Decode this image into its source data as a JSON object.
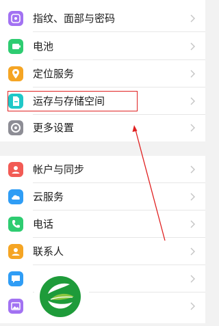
{
  "settings": {
    "items": [
      {
        "label": "指纹、面部与密码",
        "icon": "fingerprint-face-icon",
        "color": "#a272f2"
      },
      {
        "label": "电池",
        "icon": "battery-icon",
        "color": "#2ecc71"
      },
      {
        "label": "定位服务",
        "icon": "location-pin-icon",
        "color": "#f5a524"
      },
      {
        "label": "运存与存储空间",
        "icon": "storage-file-icon",
        "color": "#1fc8c8"
      },
      {
        "label": "更多设置",
        "icon": "more-settings-gear-icon",
        "color": "#8d8d95"
      },
      {
        "label": "帐户与同步",
        "icon": "account-sync-icon",
        "color": "#f25b55"
      },
      {
        "label": "云服务",
        "icon": "cloud-icon",
        "color": "#2f9df5"
      },
      {
        "label": "电话",
        "icon": "phone-icon",
        "color": "#2ecc71"
      },
      {
        "label": "联系人",
        "icon": "contacts-icon",
        "color": "#f5a524"
      },
      {
        "label": "",
        "icon": "message-icon",
        "color": "#2f9df5"
      },
      {
        "label": "",
        "icon": "gallery-icon",
        "color": "#a272f2"
      }
    ]
  },
  "overlay": {
    "highlight_color": "#e02020",
    "arrow_color": "#e02020",
    "logo_colors": [
      "#1e9b3a",
      "#8cc63f"
    ]
  }
}
